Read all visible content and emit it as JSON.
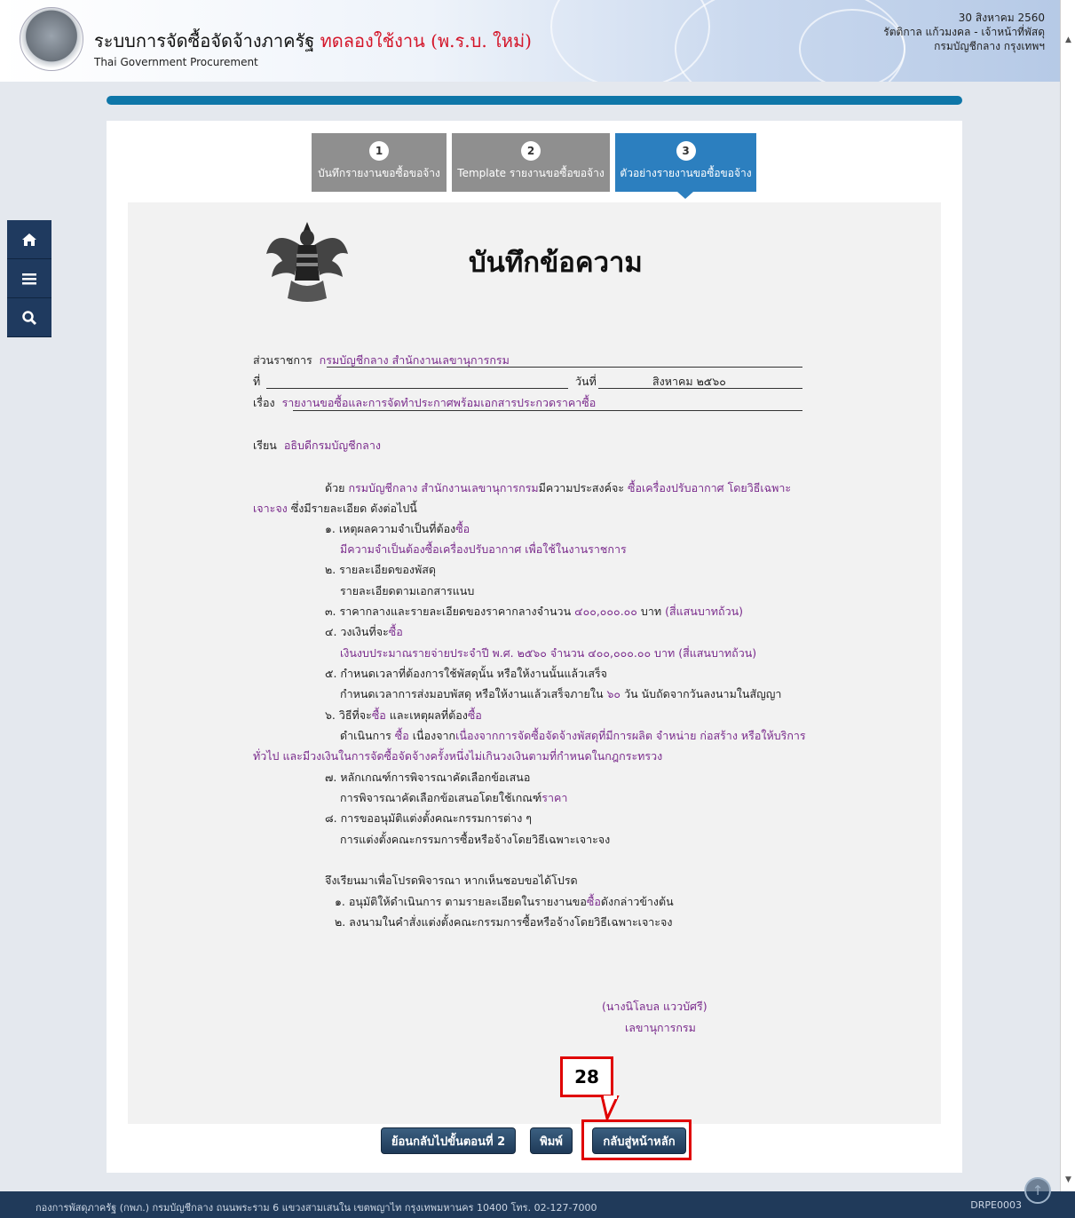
{
  "header": {
    "title_main": "ระบบการจัดซื้อจัดจ้างภาครัฐ",
    "title_trial": "ทดลองใช้งาน (พ.ร.บ. ใหม่)",
    "subtitle": "Thai Government Procurement",
    "date": "30 สิงหาคม 2560",
    "user": "รัตติกาล แก้วมงคล - เจ้าหน้าที่พัสดุ",
    "dept": "กรมบัญชีกลาง กรุงเทพฯ"
  },
  "sidebar": {
    "home_icon": "home-icon",
    "menu_icon": "menu-icon",
    "search_icon": "search-icon"
  },
  "steps": [
    {
      "num": "1",
      "label": "บันทึกรายงานขอซื้อขอจ้าง"
    },
    {
      "num": "2",
      "label": "Template รายงานขอซื้อขอจ้าง"
    },
    {
      "num": "3",
      "label": "ตัวอย่างรายงานขอซื้อขอจ้าง"
    }
  ],
  "doc": {
    "title": "บันทึกข้อความ",
    "agency_label": "ส่วนราชการ",
    "agency": "กรมบัญชีกลาง สำนักงานเลขานุการกรม",
    "ref_label": "ที่",
    "date_label": "วันที่",
    "date": "สิงหาคม ๒๕๖๐",
    "subject_label": "เรื่อง",
    "subject": "รายงานขอซื้อและการจัดทำประกาศพร้อมเอกสารประกวดราคาซื้อ",
    "to_label": "เรียน",
    "to": "อธิบดีกรมบัญชีกลาง",
    "p1_a": "ด้วย",
    "p1_org": "กรมบัญชีกลาง สำนักงานเลขานุการกรม",
    "p1_b": "มีความประสงค์จะ",
    "p1_item": "ซื้อเครื่องปรับอากาศ โดยวิธีเฉพาะ",
    "p1_c": "เจาะจง",
    "p1_d": "ซึ่งมีรายละเอียด ดังต่อไปนี้",
    "i1_a": "๑. เหตุผลความจำเป็นที่ต้อง",
    "i1_b": "ซื้อ",
    "i1_detail": "มีความจำเป็นต้องซื้อเครื่องปรับอากาศ เพื่อใช้ในงานราชการ",
    "i2": "๒. รายละเอียดของพัสดุ",
    "i2_detail": "รายละเอียดตามเอกสารแนบ",
    "i3_a": "๓. ราคากลางและรายละเอียดของราคากลางจำนวน",
    "i3_amount": "๔๐๐,๐๐๐.๐๐",
    "i3_b": "บาท",
    "i3_words": "(สี่แสนบาทถ้วน)",
    "i4_a": "๔. วงเงินที่จะ",
    "i4_b": "ซื้อ",
    "i4_detail": "เงินงบประมาณรายจ่ายประจำปี พ.ศ. ๒๕๖๐ จำนวน ๔๐๐,๐๐๐.๐๐ บาท (สี่แสนบาทถ้วน)",
    "i5": "๕. กำหนดเวลาที่ต้องการใช้พัสดุนั้น หรือให้งานนั้นแล้วเสร็จ",
    "i5_a": "กำหนดเวลาการส่งมอบพัสดุ หรือให้งานแล้วเสร็จภายใน",
    "i5_days": "๖๐",
    "i5_b": "วัน นับถัดจากวันลงนามในสัญญา",
    "i6_a": "๖. วิธีที่จะ",
    "i6_b": "ซื้อ",
    "i6_c": "และเหตุผลที่ต้อง",
    "i6_d": "ซื้อ",
    "i6_detail_a": "ดำเนินการ",
    "i6_detail_b": "ซื้อ",
    "i6_detail_c": "เนื่องจาก",
    "i6_detail_d": "เนื่องจากการจัดซื้อจัดจ้างพัสดุที่มีการผลิต จำหน่าย ก่อสร้าง หรือให้บริการ",
    "i6_detail_e": "ทั่วไป และมีวงเงินในการจัดซื้อจัดจ้างครั้งหนึ่งไม่เกินวงเงินตามที่กำหนดในกฎกระทรวง",
    "i7": "๗. หลักเกณฑ์การพิจารณาคัดเลือกข้อเสนอ",
    "i7_a": "การพิจารณาคัดเลือกข้อเสนอโดยใช้เกณฑ์",
    "i7_b": "ราคา",
    "i8": "๘. การขออนุมัติแต่งตั้งคณะกรรมการต่าง ๆ",
    "i8_detail": "การแต่งตั้งคณะกรรมการซื้อหรือจ้างโดยวิธีเฉพาะเจาะจง",
    "closing": "จึงเรียนมาเพื่อโปรดพิจารณา หากเห็นชอบขอได้โปรด",
    "c1_a": "๑. อนุมัติให้ดำเนินการ ตามรายละเอียดในรายงานขอ",
    "c1_b": "ซื้อ",
    "c1_c": "ดังกล่าวข้างต้น",
    "c2": "๒. ลงนามในคำสั่งแต่งตั้งคณะกรรมการซื้อหรือจ้างโดยวิธีเฉพาะเจาะจง",
    "signer": "(นางนิโลบล แววบัศรี)",
    "signer_title": "เลขานุการกรม"
  },
  "buttons": {
    "back": "ย้อนกลับไปขั้นตอนที่ 2",
    "print": "พิมพ์",
    "home": "กลับสู่หน้าหลัก"
  },
  "annotation": {
    "number": "28"
  },
  "footer": {
    "address": "กองการพัสดุภาครัฐ (กพภ.) กรมบัญชีกลาง ถนนพระราม 6 แขวงสามเสนใน เขตพญาไท กรุงเทพมหานคร 10400 โทร. 02-127-7000",
    "code": "DRPE0003"
  },
  "colors": {
    "accent": "#2c7fbf",
    "purple_text": "#7a2b8c",
    "trial_red": "#d4162a",
    "annotation_red": "#e00000"
  }
}
